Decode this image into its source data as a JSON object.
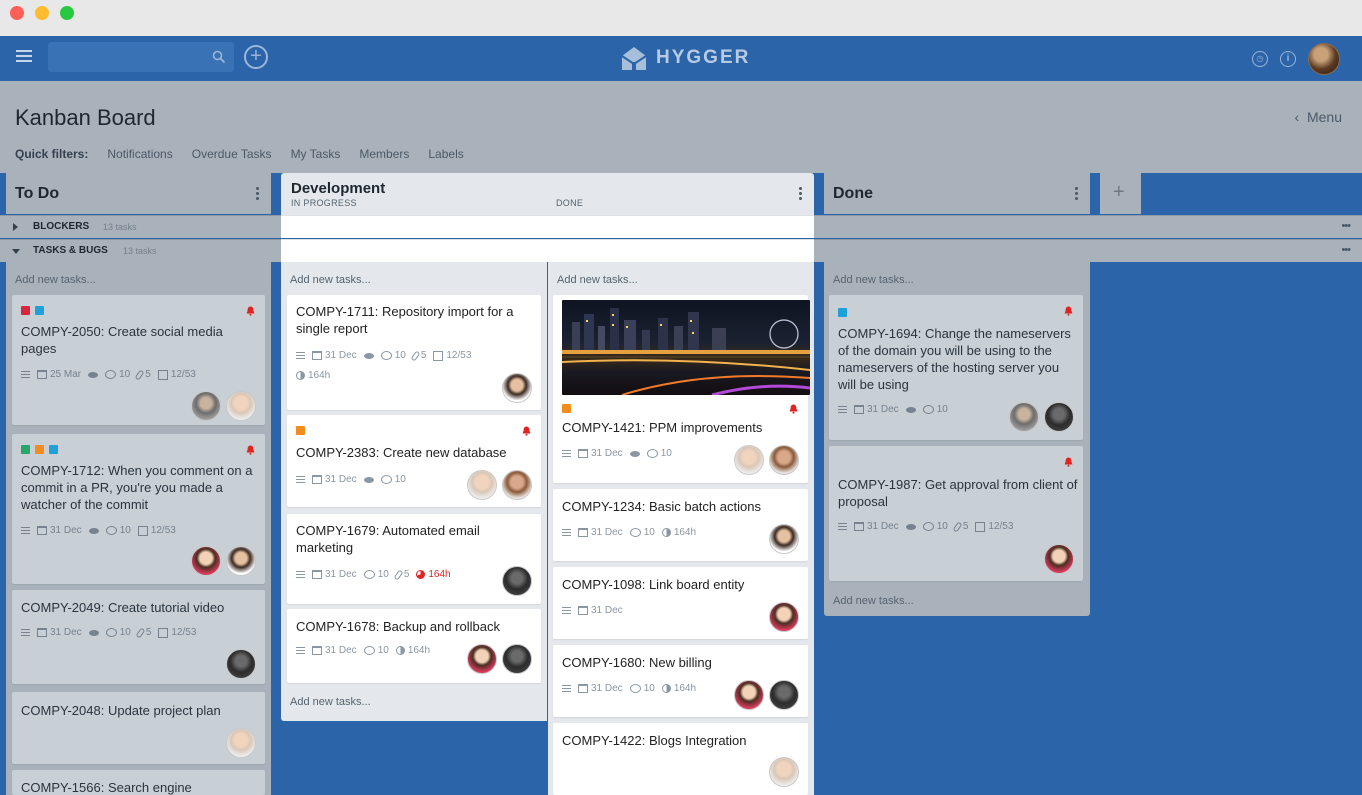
{
  "app": {
    "logo_text": "HYGGER"
  },
  "page": {
    "title": "Kanban Board",
    "menu_label": "Menu",
    "quick_filters_label": "Quick filters:",
    "filters": [
      "Notifications",
      "Overdue Tasks",
      "My Tasks",
      "Members",
      "Labels"
    ]
  },
  "columns": {
    "todo": {
      "title": "To Do"
    },
    "development": {
      "title": "Development",
      "sub_in_progress": "IN PROGRESS",
      "sub_done": "DONE"
    },
    "done": {
      "title": "Done"
    }
  },
  "swimlanes": [
    {
      "title": "BLOCKERS",
      "count": "13 tasks"
    },
    {
      "title": "TASKS & BUGS",
      "count": "13 tasks"
    }
  ],
  "add_new": "Add new tasks...",
  "colors": {
    "red": "#d7263d",
    "blue": "#1ea0d8",
    "green": "#27a56b",
    "orange": "#f28c1c",
    "appbar": "#2b64a8"
  },
  "cards": {
    "t1": {
      "title": "COMPY-2050: Create social media pages",
      "date": "25 Mar",
      "comments": "10",
      "attach": "5",
      "checks": "12/53"
    },
    "t2": {
      "title": "COMPY-1712: When you comment on a commit in a PR, you're you made a watcher of the commit",
      "date": "31 Dec",
      "comments": "10",
      "checks": "12/53"
    },
    "t3": {
      "title": "COMPY-2049: Create tutorial video",
      "date": "31 Dec",
      "comments": "10",
      "attach": "5",
      "checks": "12/53"
    },
    "t4": {
      "title": "COMPY-2048: Update project plan"
    },
    "t5": {
      "title": "COMPY-1566: Search engine"
    },
    "d1": {
      "title": "COMPY-1711: Repository import for a single report",
      "date": "31 Dec",
      "comments": "10",
      "attach": "5",
      "checks": "12/53",
      "time": "164h"
    },
    "d2": {
      "title": "COMPY-2383: Create new database",
      "date": "31 Dec",
      "comments": "10"
    },
    "d3": {
      "title": "COMPY-1679: Automated email marketing",
      "date": "31 Dec",
      "comments": "10",
      "attach": "5",
      "time": "164h"
    },
    "d4": {
      "title": "COMPY-1678: Backup and rollback",
      "date": "31 Dec",
      "comments": "10",
      "time": "164h"
    },
    "e1": {
      "title": "COMPY-1421: PPM improvements",
      "date": "31 Dec",
      "comments": "10"
    },
    "e2": {
      "title": "COMPY-1234: Basic batch actions",
      "date": "31 Dec",
      "comments": "10",
      "time": "164h"
    },
    "e3": {
      "title": "COMPY-1098: Link board entity",
      "date": "31 Dec"
    },
    "e4": {
      "title": "COMPY-1680: New billing",
      "date": "31 Dec",
      "comments": "10",
      "time": "164h"
    },
    "e5": {
      "title": "COMPY-1422: Blogs Integration"
    },
    "f1": {
      "title": "COMPY-1694: Change the nameservers of the domain you will be using to the nameservers of the hosting server you will be using",
      "date": "31 Dec",
      "comments": "10"
    },
    "f2": {
      "title": "COMPY-1987: Get approval from client of proposal",
      "date": "31 Dec",
      "comments": "10",
      "attach": "5",
      "checks": "12/53"
    }
  }
}
